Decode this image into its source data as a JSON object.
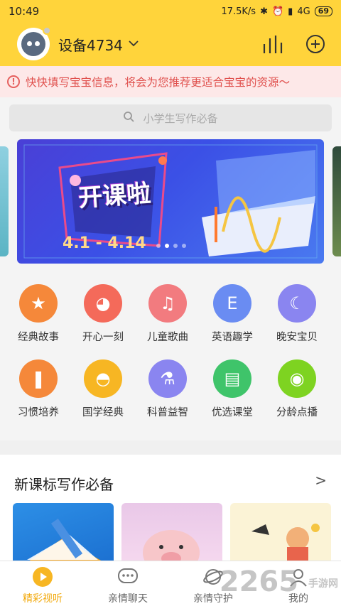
{
  "status_bar": {
    "time": "10:49",
    "speed": "17.5K/s",
    "network": "4G",
    "battery": "69"
  },
  "header": {
    "device_name": "设备4734",
    "icons": [
      "avatar-icon",
      "chevron-down-icon",
      "stats-icon",
      "add-icon"
    ]
  },
  "notice": {
    "text": "快快填写宝宝信息，将会为您推荐更适合宝宝的资源～"
  },
  "search": {
    "placeholder": "小学生写作必备"
  },
  "banner": {
    "title": "开课啦",
    "dates": "4.1 - 4.14",
    "slide_count": 4,
    "active_slide": 2
  },
  "categories": [
    {
      "label": "经典故事",
      "color": "#F5883A",
      "icon": "star-icon"
    },
    {
      "label": "开心一刻",
      "color": "#F46A5A",
      "icon": "dog-icon"
    },
    {
      "label": "儿童歌曲",
      "color": "#F27B7F",
      "icon": "music-icon"
    },
    {
      "label": "英语趣学",
      "color": "#6A8CF2",
      "icon": "english-icon"
    },
    {
      "label": "晚安宝贝",
      "color": "#8A85F0",
      "icon": "moon-icon"
    },
    {
      "label": "习惯培养",
      "color": "#F5883A",
      "icon": "toothbrush-icon"
    },
    {
      "label": "国学经典",
      "color": "#F7B623",
      "icon": "fan-icon"
    },
    {
      "label": "科普益智",
      "color": "#8A85F0",
      "icon": "flask-icon"
    },
    {
      "label": "优选课堂",
      "color": "#3FC46A",
      "icon": "book-icon"
    },
    {
      "label": "分龄点播",
      "color": "#7ED321",
      "icon": "disc-icon"
    }
  ],
  "section": {
    "title": "新课标写作必备",
    "more": ">"
  },
  "tabs": [
    {
      "label": "精彩视听",
      "active": true,
      "icon": "play-icon"
    },
    {
      "label": "亲情聊天",
      "active": false,
      "icon": "chat-icon"
    },
    {
      "label": "亲情守护",
      "active": false,
      "icon": "planet-icon"
    },
    {
      "label": "我的",
      "active": false,
      "icon": "profile-icon"
    }
  ],
  "watermark": {
    "brand": "2265",
    "sub": "手游网"
  },
  "colors": {
    "header_bg": "#FFD43B",
    "notice_bg": "#FDE8E8",
    "notice_text": "#E0504D",
    "tab_active": "#F2A90C"
  }
}
